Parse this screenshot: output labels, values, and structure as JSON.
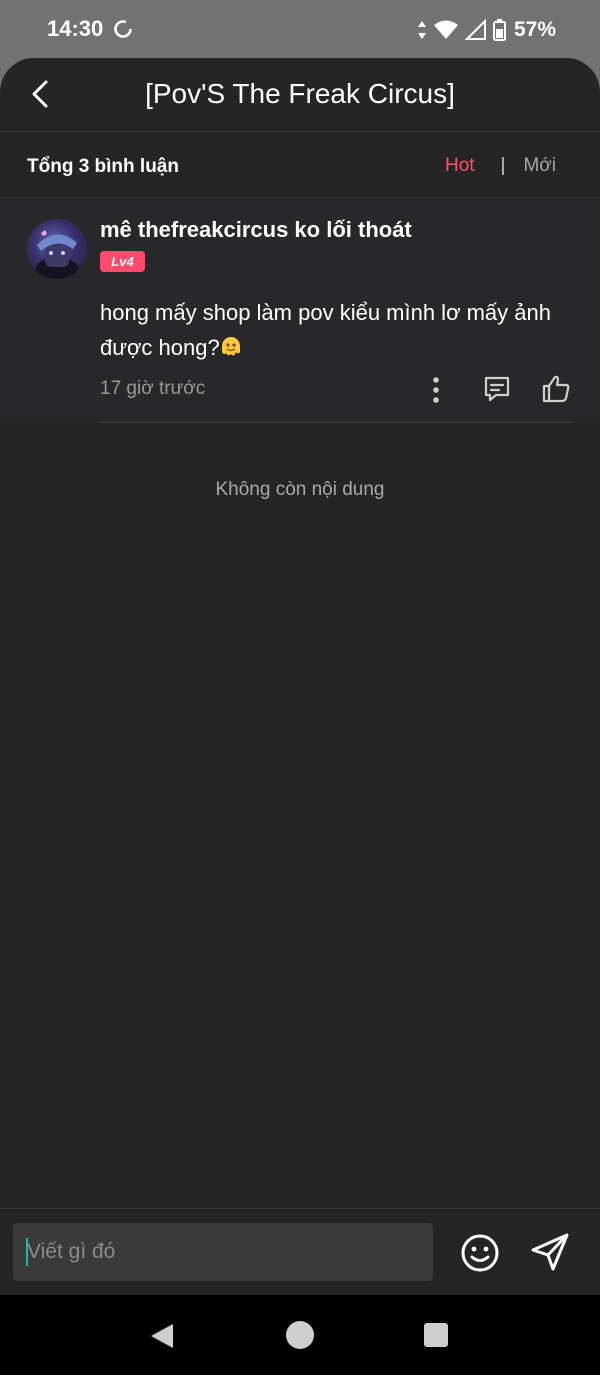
{
  "status_bar": {
    "time": "14:30",
    "battery": "57%"
  },
  "header": {
    "title": "[Pov'S The Freak Circus]"
  },
  "subheader": {
    "count_label": "Tổng 3 bình luận",
    "tabs": [
      {
        "label": "Hot",
        "active": true
      },
      {
        "label": "Mới",
        "active": false
      }
    ],
    "separator": "|"
  },
  "comments": [
    {
      "username": "mê thefreakcircus ko lối thoát",
      "level": "Lv4",
      "text": "hong mấy shop làm pov kiểu mình lơ mấy ảnh được hong?",
      "time": "17 giờ trước"
    }
  ],
  "end_message": "Không còn nội dung",
  "composer": {
    "placeholder": "Viết gì đó"
  },
  "colors": {
    "accent": "#ff4f6d",
    "background": "#252525",
    "statusbar": "#727272"
  }
}
